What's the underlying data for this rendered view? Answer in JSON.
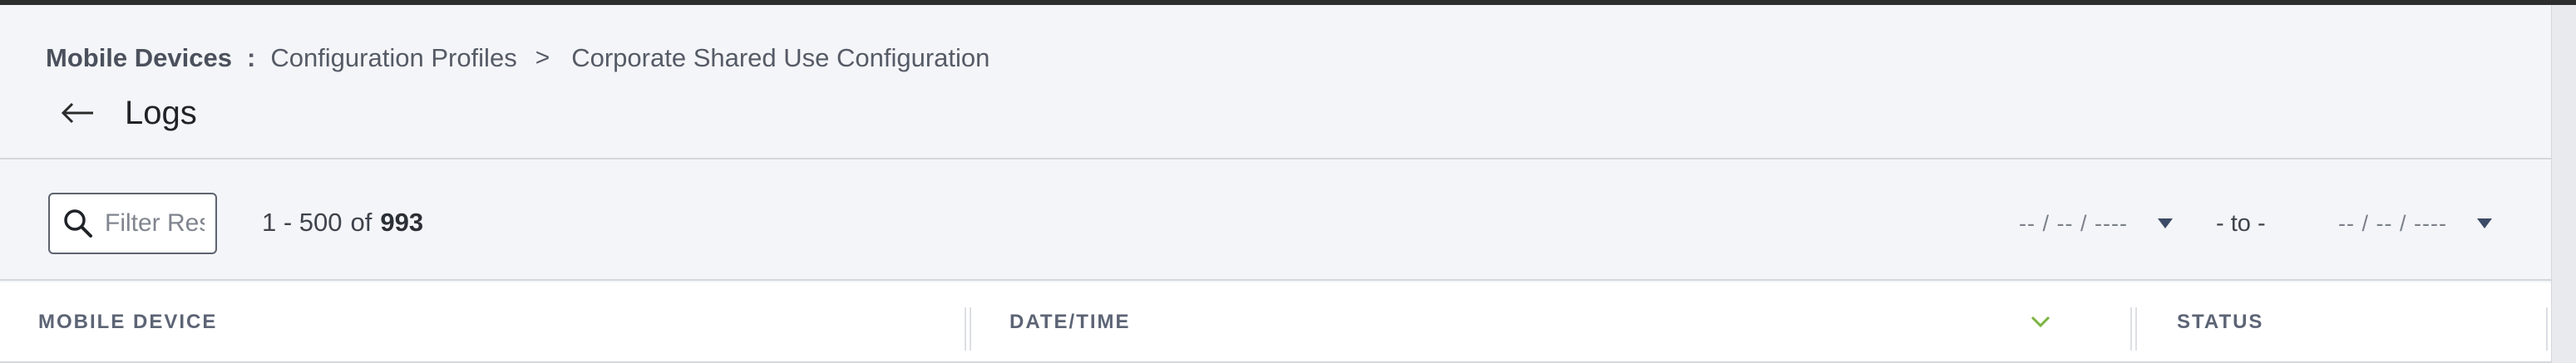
{
  "breadcrumb": {
    "root": "Mobile Devices",
    "colon": ":",
    "section": "Configuration Profiles",
    "chevron": ">",
    "current": "Corporate Shared Use Configuration"
  },
  "header": {
    "title": "Logs",
    "back_icon": "arrow-left-icon"
  },
  "toolbar": {
    "filter": {
      "placeholder": "Filter Results",
      "value": "",
      "icon": "search-icon"
    },
    "pagination": {
      "range": "1 - 500",
      "of": "of",
      "total": "993"
    },
    "date_range": {
      "from": "-- / -- / ----",
      "to_label": "- to -",
      "to": "-- / -- / ----"
    }
  },
  "table": {
    "columns": [
      {
        "label": "MOBILE DEVICE"
      },
      {
        "label": "DATE/TIME",
        "sorted": "descending"
      },
      {
        "label": "STATUS"
      }
    ]
  },
  "colors": {
    "background": "#f4f5f8",
    "sort_accent": "#7cb342",
    "caret": "#3b4a66",
    "column_header_text": "#5c6475"
  }
}
